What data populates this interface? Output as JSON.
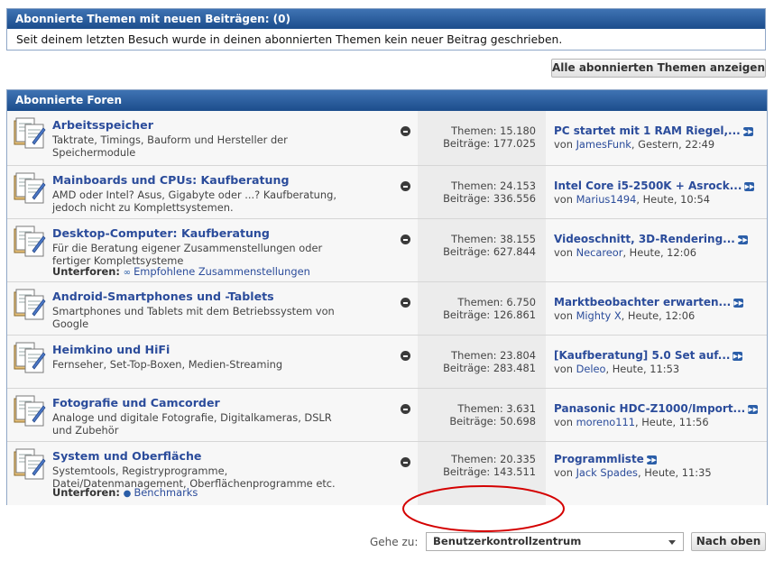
{
  "subscribed_threads": {
    "title": "Abonnierte Themen mit neuen Beiträgen: (0)",
    "message": "Seit deinem letzten Besuch wurde in deinen abonnierten Themen kein neuer Beitrag geschrieben.",
    "show_all_button": "Alle abonnierten Themen anzeigen"
  },
  "subscribed_forums": {
    "title": "Abonnierte Foren",
    "forums": [
      {
        "title": "Arbeitsspeicher",
        "description": "Taktrate, Timings, Bauform und Hersteller der Speichermodule",
        "threads": "Themen: 15.180",
        "posts": "Beiträge: 177.025",
        "last_post_title": "PC startet mit 1 RAM Riegel,...",
        "last_post_by": "von",
        "last_post_user": "JamesFunk",
        "last_post_time": ", Gestern, 22:49"
      },
      {
        "title": "Mainboards und CPUs: Kaufberatung",
        "description": "AMD oder Intel? Asus, Gigabyte oder ...? Kaufberatung, jedoch nicht zu Komplettsystemen.",
        "threads": "Themen: 24.153",
        "posts": "Beiträge: 336.556",
        "last_post_title": "Intel Core i5-2500K + Asrock...",
        "last_post_by": "von",
        "last_post_user": "Marius1494",
        "last_post_time": ", Heute, 10:54"
      },
      {
        "title": "Desktop-Computer: Kaufberatung",
        "description": "Für die Beratung eigener Zusammenstellungen oder fertiger Komplettsysteme",
        "subforums_label": "Unterforen:",
        "subforum": "Empfohlene Zusammenstellungen",
        "threads": "Themen: 38.155",
        "posts": "Beiträge: 627.844",
        "last_post_title": "Videoschnitt, 3D-Rendering...",
        "last_post_by": "von",
        "last_post_user": "Necareor",
        "last_post_time": ", Heute, 12:06"
      },
      {
        "title": "Android-Smartphones und -Tablets",
        "description": "Smartphones und Tablets mit dem Betriebssystem von Google",
        "threads": "Themen: 6.750",
        "posts": "Beiträge: 126.861",
        "last_post_title": "Marktbeobachter erwarten...",
        "last_post_by": "von",
        "last_post_user": "Mighty X",
        "last_post_time": ", Heute, 12:06"
      },
      {
        "title": "Heimkino und HiFi",
        "description": "Fernseher, Set-Top-Boxen, Medien-Streaming",
        "threads": "Themen: 23.804",
        "posts": "Beiträge: 283.481",
        "last_post_title": "[Kaufberatung] 5.0 Set auf...",
        "last_post_by": "von",
        "last_post_user": "Deleo",
        "last_post_time": ", Heute, 11:53"
      },
      {
        "title": "Fotografie und Camcorder",
        "description": "Analoge und digitale Fotografie, Digitalkameras, DSLR und Zubehör",
        "threads": "Themen: 3.631",
        "posts": "Beiträge: 50.698",
        "last_post_title": "Panasonic HDC-Z1000/Import...",
        "last_post_by": "von",
        "last_post_user": "moreno111",
        "last_post_time": ", Heute, 11:56"
      },
      {
        "title": "System und Oberfläche",
        "description": "Systemtools, Registryprogramme, Datei/Datenmanagement, Oberflächenprogramme etc.",
        "subforums_label": "Unterforen:",
        "subforum": "Benchmarks",
        "threads": "Themen: 20.335",
        "posts": "Beiträge: 143.511",
        "last_post_title": "Programmliste",
        "last_post_by": "von",
        "last_post_user": "Jack Spades",
        "last_post_time": ", Heute, 11:35"
      }
    ]
  },
  "footer": {
    "goto_label": "Gehe zu:",
    "goto_selected": "Benutzerkontrollzentrum",
    "top_button": "Nach oben"
  },
  "colors": {
    "header_bar": "#1c4d8c",
    "link": "#2b4c9b",
    "annotation": "#d40000"
  }
}
